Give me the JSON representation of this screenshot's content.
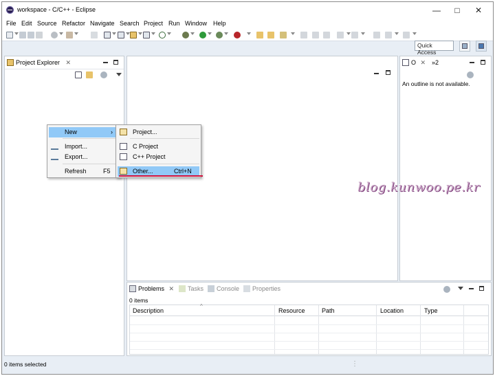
{
  "window": {
    "title": "workspace - C/C++ - Eclipse"
  },
  "menu": [
    "File",
    "Edit",
    "Source",
    "Refactor",
    "Navigate",
    "Search",
    "Project",
    "Run",
    "Window",
    "Help"
  ],
  "quick_access": "Quick Access",
  "project_explorer": {
    "tab_label": "Project Explorer"
  },
  "outline": {
    "tab_label": "O",
    "overflow_label": "»2",
    "message": "An outline is not available."
  },
  "context_menu": {
    "items": [
      {
        "label": "New",
        "shortcut": "",
        "arrow": "›"
      },
      {
        "label": "Import...",
        "shortcut": ""
      },
      {
        "label": "Export...",
        "shortcut": ""
      },
      {
        "label": "Refresh",
        "shortcut": "F5"
      }
    ]
  },
  "submenu": {
    "items": [
      {
        "label": "Project...",
        "shortcut": ""
      },
      {
        "label": "C Project",
        "shortcut": ""
      },
      {
        "label": "C++ Project",
        "shortcut": ""
      },
      {
        "label": "Other...",
        "shortcut": "Ctrl+N"
      }
    ]
  },
  "bottom_panel": {
    "tabs": [
      "Problems",
      "Tasks",
      "Console",
      "Properties"
    ],
    "count_text": "0 items",
    "columns": [
      "Description",
      "Resource",
      "Path",
      "Location",
      "Type"
    ]
  },
  "status": {
    "text": "0 items selected"
  },
  "watermark": "blog.kunwoo.pe.kr",
  "colors": {
    "highlight": "#91c9f7",
    "underline": "#d0103a",
    "background": "#e8eef5"
  }
}
